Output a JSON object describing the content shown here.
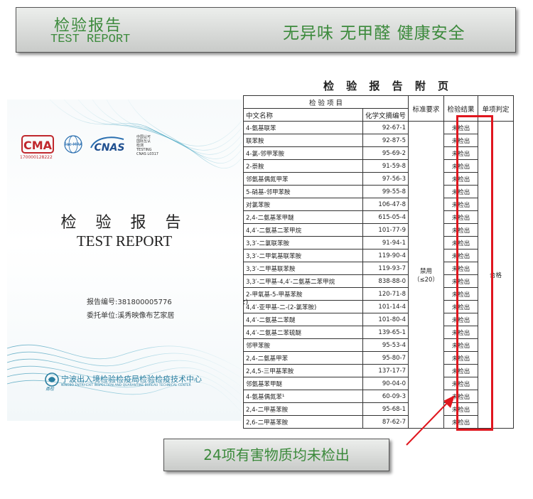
{
  "banner": {
    "title_cn": "检验报告",
    "title_en": "TEST REPORT",
    "slogan": "无异味 无甲醛 健康安全"
  },
  "cover": {
    "cma_label": "CMA",
    "cma_number": "170000128222",
    "mra_label": "ilac-MRA",
    "cnas_label": "CNAS",
    "cnas_text": [
      "中国认可",
      "国际互认",
      "检测",
      "TESTING",
      "CNAS L0317"
    ],
    "title_cn": "检 验 报 告",
    "title_en": "TEST REPORT",
    "report_no": "报告编号:381800005776",
    "client": "委托单位:溪秀映像布艺家居",
    "org_name": "宁波出入境检验检疫局检验检疫技术中心",
    "org_name_en": "NINGBO ENTRY-EXIT INSPECTION AND QUARANTINE BUREAU TECHNICAL CENTER",
    "org_brand": "甬检"
  },
  "appendix": {
    "title": "检 验 报 告 附 页",
    "headers": {
      "item": "检 验 项 目",
      "cn_name": "中文名称",
      "cas": "化学文摘编号",
      "standard": "标准要求",
      "result": "检验结果",
      "judgement": "单项判定"
    },
    "standard_value": "禁用\n（≤20）",
    "judgement_value": "合格",
    "side_mark": ":)",
    "rows": [
      {
        "name": "4-氨基联苯",
        "cas": "92-67-1",
        "result": "未检出"
      },
      {
        "name": "联苯胺",
        "cas": "92-87-5",
        "result": "未检出"
      },
      {
        "name": "4-氯-邻甲苯胺",
        "cas": "95-69-2",
        "result": "未检出"
      },
      {
        "name": "2-萘胺",
        "cas": "91-59-8",
        "result": "未检出"
      },
      {
        "name": "邻氨基偶氮甲苯",
        "cas": "97-56-3",
        "result": "未检出"
      },
      {
        "name": "5-硝基-邻甲苯胺",
        "cas": "99-55-8",
        "result": "未检出"
      },
      {
        "name": "对氯苯胺",
        "cas": "106-47-8",
        "result": "未检出"
      },
      {
        "name": "2,4-二氨基苯甲醚",
        "cas": "615-05-4",
        "result": "未检出"
      },
      {
        "name": "4,4′-二氨基二苯甲烷",
        "cas": "101-77-9",
        "result": "未检出"
      },
      {
        "name": "3,3′-二氯联苯胺",
        "cas": "91-94-1",
        "result": "未检出"
      },
      {
        "name": "3,3′-二甲氧基联苯胺",
        "cas": "119-90-4",
        "result": "未检出"
      },
      {
        "name": "3,3′-二甲基联苯胺",
        "cas": "119-93-7",
        "result": "未检出"
      },
      {
        "name": "3,3′-二甲基-4,4′-二氨基二苯甲烷",
        "cas": "838-88-0",
        "result": "未检出"
      },
      {
        "name": "2-甲氧基-5-甲基苯胺",
        "cas": "120-71-8",
        "result": "未检出"
      },
      {
        "name": "4,4′-亚甲基-二-(2-氯苯胺)",
        "cas": "101-14-4",
        "result": "未检出"
      },
      {
        "name": "4,4′-二氨基二苯醚",
        "cas": "101-80-4",
        "result": "未检出"
      },
      {
        "name": "4,4′-二氨基二苯硫醚",
        "cas": "139-65-1",
        "result": "未检出"
      },
      {
        "name": "邻甲苯胺",
        "cas": "95-53-4",
        "result": "未检出"
      },
      {
        "name": "2,4-二氨基甲苯",
        "cas": "95-80-7",
        "result": "未检出"
      },
      {
        "name": "2,4,5-三甲基苯胺",
        "cas": "137-17-7",
        "result": "未检出"
      },
      {
        "name": "邻氨基苯甲醚",
        "cas": "90-04-0",
        "result": "未检出"
      },
      {
        "name": "4-氨基偶氮苯¹",
        "cas": "60-09-3",
        "result": "未检出"
      },
      {
        "name": "2,4-二甲基苯胺",
        "cas": "95-68-1",
        "result": "未检出"
      },
      {
        "name": "2,6-二甲基苯胺",
        "cas": "87-62-7",
        "result": "未检出"
      }
    ]
  },
  "caption": "24项有害物质均未检出",
  "colors": {
    "accent_green": "#3c8a3c",
    "highlight_red": "#e0161e",
    "org_blue": "#2a7ea0"
  }
}
